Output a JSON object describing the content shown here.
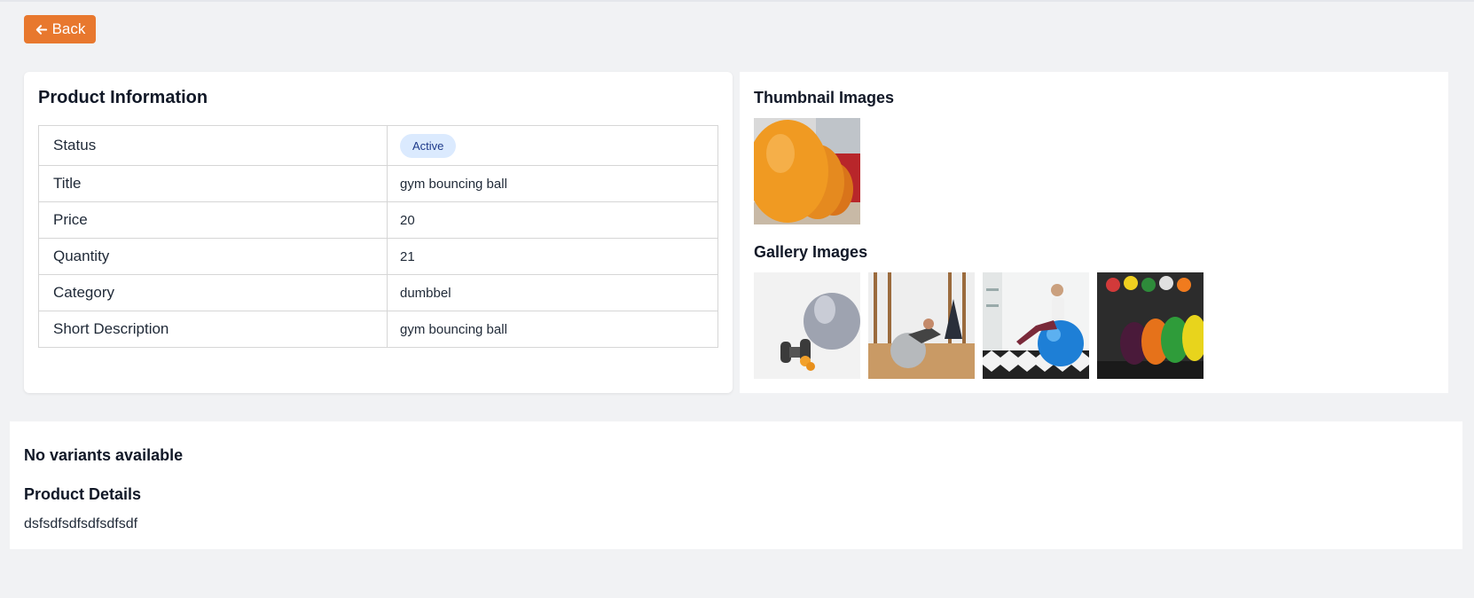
{
  "header": {
    "back_label": "Back"
  },
  "product_info": {
    "title": "Product Information",
    "rows": [
      {
        "label": "Status",
        "value": "Active",
        "type": "badge"
      },
      {
        "label": "Title",
        "value": "gym bouncing ball"
      },
      {
        "label": "Price",
        "value": "20"
      },
      {
        "label": "Quantity",
        "value": "21"
      },
      {
        "label": "Category",
        "value": "dumbbel"
      },
      {
        "label": "Short Description",
        "value": "gym bouncing ball"
      }
    ]
  },
  "media": {
    "thumbnail_title": "Thumbnail Images",
    "gallery_title": "Gallery Images",
    "thumbnail_images": [
      "orange-gym-balls-photo"
    ],
    "gallery_images": [
      "gray-ball-and-dumbbells-photo",
      "woman-exercising-on-ball-photo",
      "woman-sitting-on-blue-ball-photo",
      "colorful-medicine-balls-photo"
    ]
  },
  "bottom": {
    "no_variants": "No variants available",
    "details_title": "Product Details",
    "details_text": "dsfsdfsdfsdfsdfsdf"
  },
  "colors": {
    "accent": "#e8782e",
    "badge_bg": "#dbeafe",
    "badge_text": "#1e3a8a",
    "page_bg": "#f1f2f4"
  }
}
